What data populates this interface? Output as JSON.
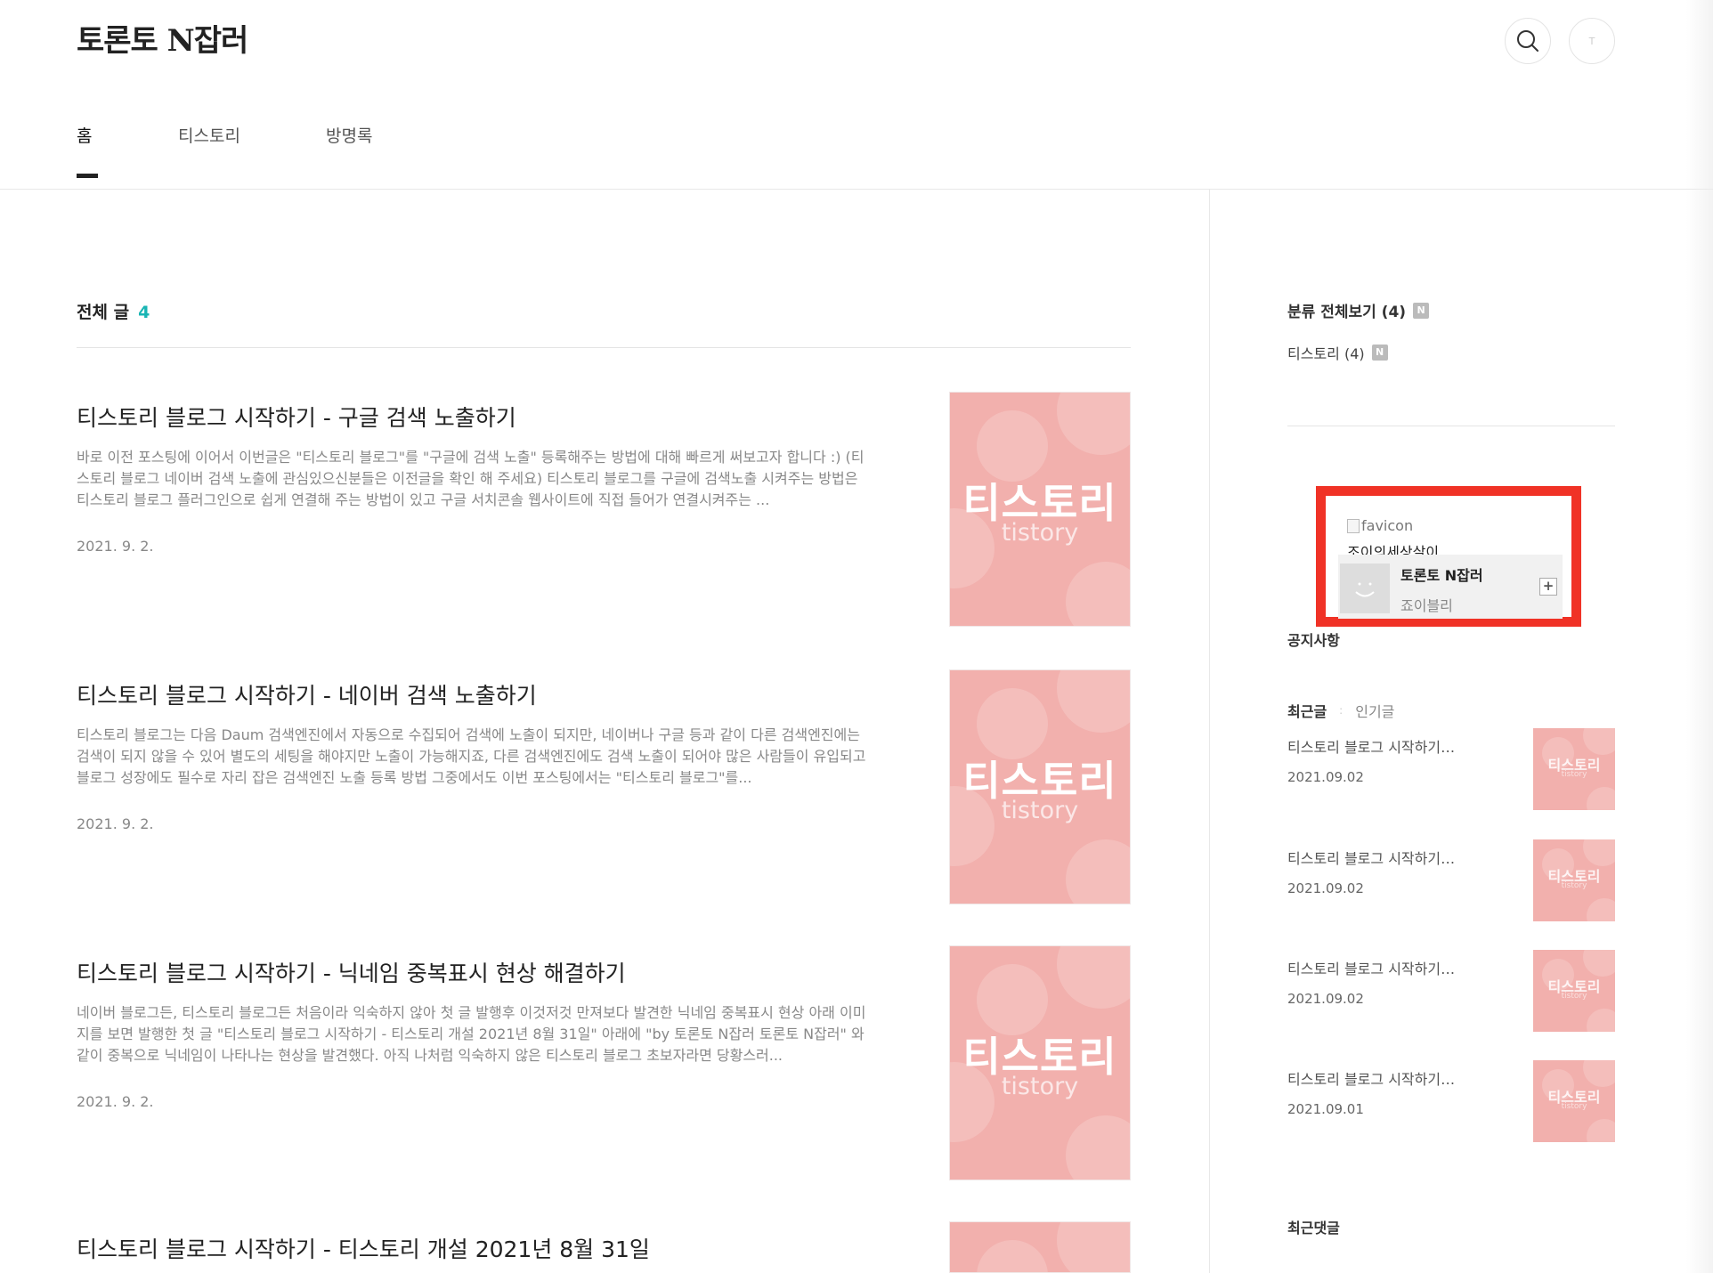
{
  "header": {
    "blog_title": "토론토 N잡러",
    "search_icon": "search-icon",
    "profile_icon_text": "T"
  },
  "nav": {
    "items": [
      {
        "label": "홈"
      },
      {
        "label": "티스토리"
      },
      {
        "label": "방명록"
      }
    ]
  },
  "main": {
    "total_label": "전체 글",
    "total_count": "4",
    "posts": [
      {
        "title": "티스토리 블로그 시작하기 - 구글 검색 노출하기",
        "excerpt": "바로 이전 포스팅에 이어서 이번글은 \"티스토리 블로그\"를 \"구글에 검색 노출\" 등록해주는 방법에 대해 빠르게 써보고자 합니다 :) (티스토리 블로그 네이버 검색 노출에 관심있으신분들은 이전글을 확인 해 주세요) 티스토리 블로그를 구글에 검색노출 시켜주는 방법은 티스토리 블로그 플러그인으로 쉽게 연결해 주는 방법이 있고 구글 서치콘솔 웹사이트에 직접 들어가 연결시켜주는 ...",
        "date": "2021. 9. 2.",
        "thumb_title": "티스토리",
        "thumb_sub": "tistory"
      },
      {
        "title": "티스토리 블로그 시작하기 - 네이버 검색 노출하기",
        "excerpt": "티스토리 블로그는 다음 Daum 검색엔진에서 자동으로 수집되어 검색에 노출이 되지만, 네이버나 구글 등과 같이 다른 검색엔진에는 검색이 되지 않을 수 있어 별도의 세팅을 해야지만 노출이 가능해지죠, 다른 검색엔진에도 검색 노출이 되어야 많은 사람들이 유입되고 블로그 성장에도 필수로 자리 잡은 검색엔진 노출 등록 방법 그중에서도 이번 포스팅에서는 \"티스토리 블로그\"를...",
        "date": "2021. 9. 2.",
        "thumb_title": "티스토리",
        "thumb_sub": "tistory"
      },
      {
        "title": "티스토리 블로그 시작하기 - 닉네임 중복표시 현상 해결하기",
        "excerpt": "네이버 블로그든, 티스토리 블로그든 처음이라 익숙하지 않아 첫 글 발행후 이것저것 만져보다 발견한 닉네임 중복표시 현상 아래 이미지를 보면 발행한 첫 글 \"티스토리 블로그 시작하기 - 티스토리 개설 2021년 8월 31일\" 아래에 \"by 토론토 N잡러 토론토 N잡러\" 와 같이 중복으로 닉네임이 나타나는 현상을 발견했다. 아직 나처럼 익숙하지 않은 티스토리 블로그 초보자라면 당황스러...",
        "date": "2021. 9. 2.",
        "thumb_title": "티스토리",
        "thumb_sub": "tistory"
      },
      {
        "title": "티스토리 블로그 시작하기 - 티스토리 개설 2021년 8월 31일",
        "excerpt": "",
        "date": "",
        "thumb_title": "",
        "thumb_sub": ""
      }
    ]
  },
  "sidebar": {
    "category_all": "분류 전체보기 (4)",
    "category_items": [
      {
        "label": "티스토리 (4)"
      }
    ],
    "new_badge": "N",
    "widget": {
      "favicon_alt": "favicon",
      "site_name": "조이의세상살이",
      "blog_name": "토론토 N잡러",
      "owner": "죠이블리",
      "plus": "+"
    },
    "notice_label": "공지사항",
    "tabs": {
      "active": "최근글",
      "inactive": "인기글"
    },
    "recent_posts": [
      {
        "title": "티스토리 블로그 시작하기…",
        "date": "2021.09.02",
        "thumb_title": "티스토리",
        "thumb_sub": "tistory"
      },
      {
        "title": "티스토리 블로그 시작하기…",
        "date": "2021.09.02",
        "thumb_title": "티스토리",
        "thumb_sub": "tistory"
      },
      {
        "title": "티스토리 블로그 시작하기…",
        "date": "2021.09.02",
        "thumb_title": "티스토리",
        "thumb_sub": "tistory"
      },
      {
        "title": "티스토리 블로그 시작하기…",
        "date": "2021.09.01",
        "thumb_title": "티스토리",
        "thumb_sub": "tistory"
      }
    ],
    "recent_comments_label": "최근댓글"
  },
  "colors": {
    "accent": "#19b5b4",
    "thumb_pink": "#f2b0ad",
    "highlight_box": "#f03226"
  }
}
